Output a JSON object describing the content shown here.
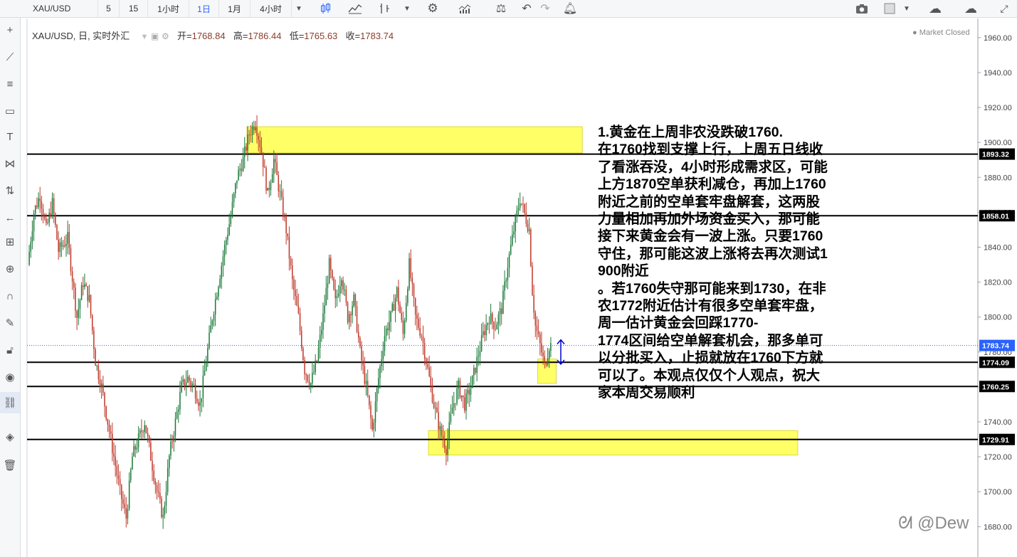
{
  "toolbar": {
    "symbol": "XAU/USD",
    "intervals": [
      "5",
      "15",
      "1小时",
      "1日",
      "1月",
      "4小时"
    ],
    "active_interval": "1日",
    "icons": [
      "caret-down-icon",
      "candles-icon",
      "area-chart-icon",
      "indicators-icon",
      "caret-down-icon",
      "settings-icon",
      "bar-chart-icon",
      "compare-icon",
      "undo-icon",
      "redo-icon",
      "alert-icon",
      "caret-down-icon",
      "camera-icon",
      "color-square-icon",
      "caret-down-icon",
      "cloud-load-icon",
      "cloud-save-icon",
      "fullscreen-icon"
    ]
  },
  "sidebar": {
    "icons": [
      "crosshair-icon",
      "trend-line-icon",
      "fib-icon",
      "rectangle-icon",
      "text-icon",
      "pattern-icon",
      "measure-icon",
      "back-arrow-icon",
      "price-range-icon",
      "zoom-icon",
      "magnet-icon",
      "lock-draw-icon",
      "lock-icon",
      "eye-icon",
      "link-icon",
      "layers-icon",
      "trash-icon"
    ],
    "active": "link-icon"
  },
  "legend": {
    "title": "XAU/USD, 日, 实时外汇",
    "open_label": "开=",
    "open": "1768.84",
    "high_label": "高=",
    "high": "1786.44",
    "low_label": "低=",
    "low": "1765.63",
    "close_label": "收=",
    "close": "1783.74"
  },
  "market_status": "Market Closed",
  "note": "1.黄金在上周非农没跌破1760.\n在1760找到支撑上行，上周五日线收\n了看涨吞没，4小时形成需求区，可能\n上方1870空单获利减仓，再加上1760\n附近之前的空单套牢盘解套，这两股\n力量相加再加外场资金买入，那可能\n接下来黄金会有一波上涨。只要1760\n守住，那可能这波上涨将去再次测试1\n900附近\n。若1760失守那可能来到1730，在非\n农1772附近估计有很多空单套牢盘，\n周一估计黄金会回踩1770-\n1774区间给空单解套机会，那多单可\n以分批买入，止损就放在1760下方就\n可以了。本观点仅仅个人观点，祝大\n家本周交易顺利",
  "watermark": "@Dew",
  "colors": {
    "up": "#1b7a3a",
    "down": "#c0392b",
    "zone": "#ffff66",
    "level_line": "#000000",
    "current_price_line": "#2962ff",
    "arrow": "#0000cc"
  },
  "chart_data": {
    "type": "candlestick",
    "symbol": "XAU/USD",
    "timeframe": "日",
    "ylim": [
      1680,
      1970
    ],
    "y_ticks": [
      1960,
      1940,
      1920,
      1900,
      1880,
      1860,
      1840,
      1820,
      1800,
      1780,
      1760,
      1740,
      1720,
      1700,
      1680
    ],
    "y_tick_labels": [
      "1960.00",
      "1940.00",
      "1920.00",
      "1900.00",
      "1880.00",
      "1860.00",
      "1840.00",
      "1820.00",
      "1800.00",
      "1780.00",
      "1760.00",
      "1740.00",
      "1720.00",
      "1700.00",
      "1680.00"
    ],
    "horizontal_levels": [
      {
        "value": 1893.32,
        "label": "1893.32",
        "style": "black"
      },
      {
        "value": 1858.01,
        "label": "1858.01",
        "style": "black"
      },
      {
        "value": 1783.74,
        "label": "1783.74",
        "style": "current"
      },
      {
        "value": 1774.09,
        "label": "1774.09",
        "style": "black"
      },
      {
        "value": 1760.25,
        "label": "1760.25",
        "style": "black"
      },
      {
        "value": 1729.91,
        "label": "1729.91",
        "style": "black"
      }
    ],
    "zones": [
      {
        "from_bar": 142,
        "to_bar": 360,
        "low": 1894,
        "high": 1909
      },
      {
        "from_bar": 331,
        "to_bar": 343,
        "low": 1762,
        "high": 1776
      },
      {
        "from_bar": 260,
        "to_bar": 500,
        "low": 1721,
        "high": 1735
      }
    ],
    "price_path": [
      [
        0,
        1830
      ],
      [
        4,
        1860
      ],
      [
        8,
        1870
      ],
      [
        12,
        1850
      ],
      [
        16,
        1865
      ],
      [
        20,
        1838
      ],
      [
        26,
        1845
      ],
      [
        32,
        1800
      ],
      [
        36,
        1820
      ],
      [
        40,
        1810
      ],
      [
        44,
        1775
      ],
      [
        48,
        1760
      ],
      [
        52,
        1740
      ],
      [
        56,
        1720
      ],
      [
        60,
        1700
      ],
      [
        64,
        1685
      ],
      [
        68,
        1720
      ],
      [
        72,
        1730
      ],
      [
        76,
        1740
      ],
      [
        80,
        1720
      ],
      [
        84,
        1700
      ],
      [
        88,
        1685
      ],
      [
        92,
        1720
      ],
      [
        96,
        1740
      ],
      [
        100,
        1760
      ],
      [
        104,
        1765
      ],
      [
        108,
        1760
      ],
      [
        112,
        1750
      ],
      [
        116,
        1775
      ],
      [
        120,
        1800
      ],
      [
        124,
        1820
      ],
      [
        128,
        1840
      ],
      [
        132,
        1858
      ],
      [
        136,
        1880
      ],
      [
        140,
        1890
      ],
      [
        144,
        1905
      ],
      [
        148,
        1912
      ],
      [
        152,
        1895
      ],
      [
        156,
        1870
      ],
      [
        160,
        1890
      ],
      [
        164,
        1870
      ],
      [
        168,
        1850
      ],
      [
        172,
        1820
      ],
      [
        176,
        1800
      ],
      [
        180,
        1770
      ],
      [
        184,
        1762
      ],
      [
        188,
        1775
      ],
      [
        192,
        1800
      ],
      [
        196,
        1830
      ],
      [
        200,
        1808
      ],
      [
        204,
        1825
      ],
      [
        208,
        1800
      ],
      [
        212,
        1810
      ],
      [
        216,
        1780
      ],
      [
        220,
        1760
      ],
      [
        224,
        1735
      ],
      [
        228,
        1765
      ],
      [
        232,
        1790
      ],
      [
        236,
        1800
      ],
      [
        240,
        1815
      ],
      [
        244,
        1790
      ],
      [
        248,
        1830
      ],
      [
        252,
        1800
      ],
      [
        256,
        1790
      ],
      [
        260,
        1770
      ],
      [
        264,
        1750
      ],
      [
        268,
        1735
      ],
      [
        272,
        1725
      ],
      [
        276,
        1748
      ],
      [
        280,
        1760
      ],
      [
        284,
        1750
      ],
      [
        288,
        1760
      ],
      [
        292,
        1775
      ],
      [
        296,
        1790
      ],
      [
        300,
        1800
      ],
      [
        304,
        1795
      ],
      [
        308,
        1805
      ],
      [
        312,
        1830
      ],
      [
        316,
        1850
      ],
      [
        320,
        1868
      ],
      [
        322,
        1862
      ],
      [
        326,
        1850
      ],
      [
        328,
        1815
      ],
      [
        330,
        1795
      ],
      [
        334,
        1780
      ],
      [
        336,
        1772
      ],
      [
        339,
        1783.74
      ]
    ],
    "bar_count": 340
  }
}
